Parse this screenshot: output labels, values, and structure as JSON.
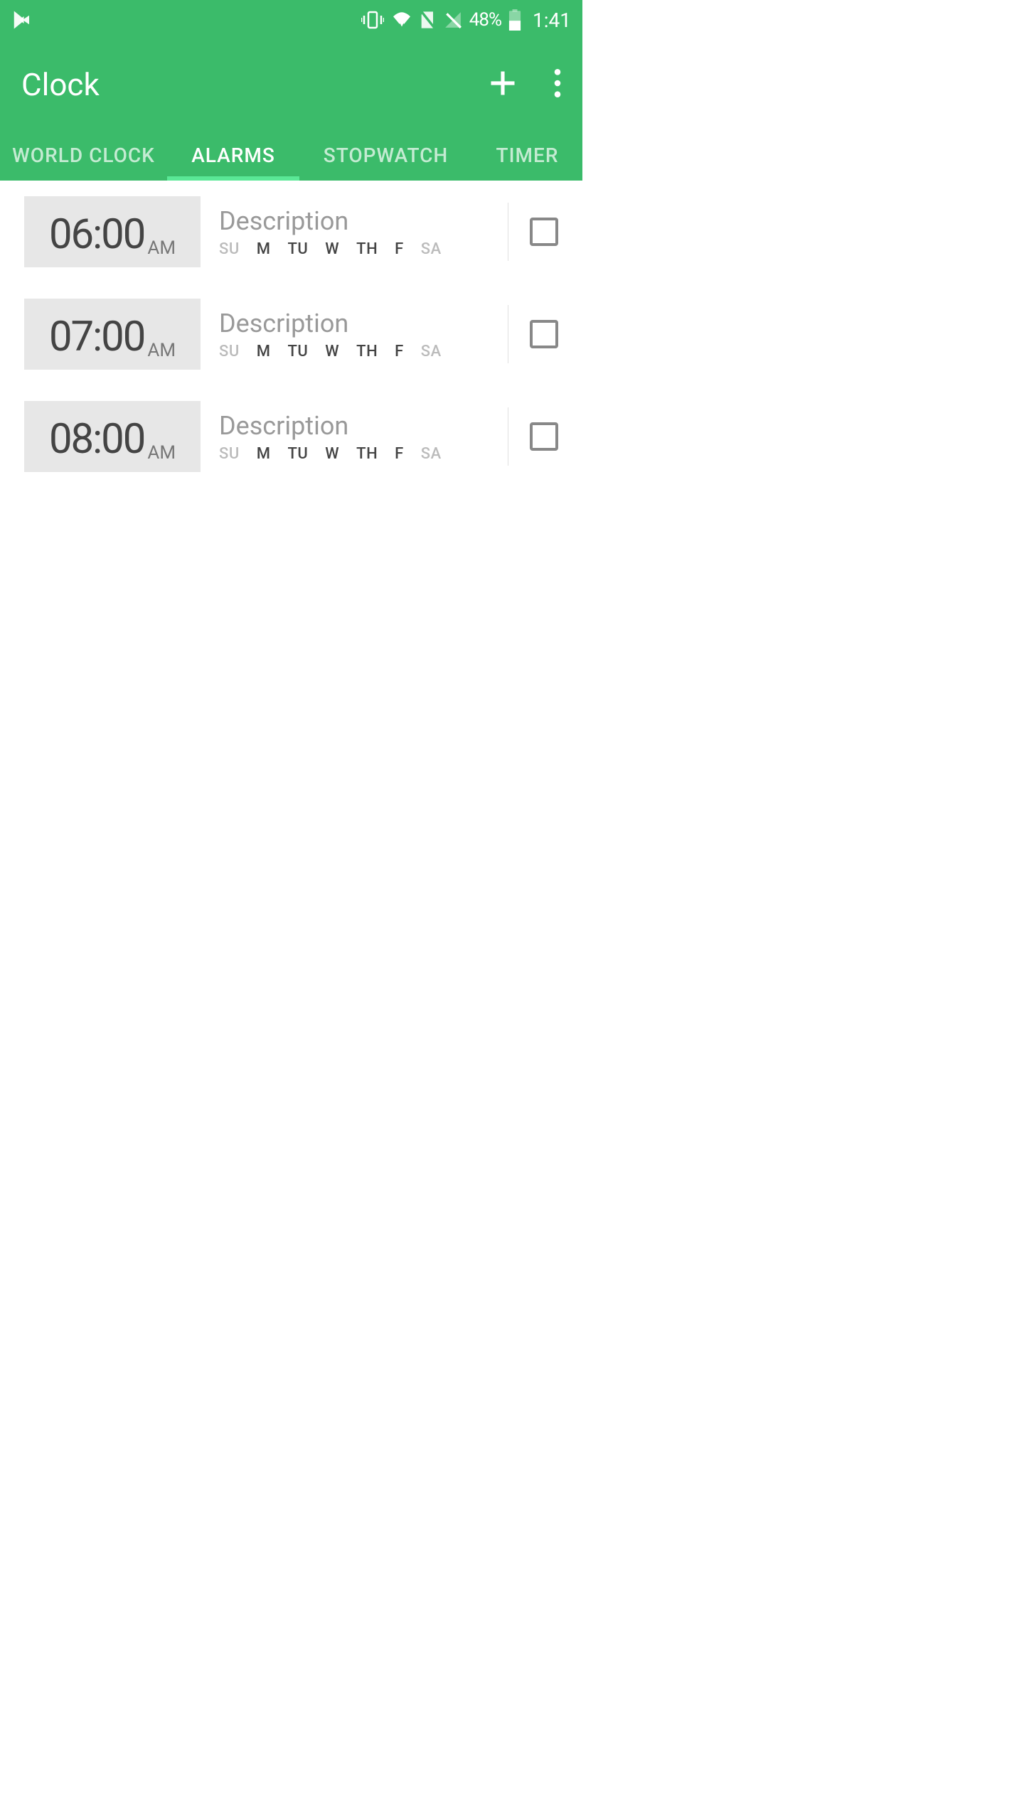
{
  "status_bar": {
    "battery_percent": "48%",
    "time": "1:41"
  },
  "header": {
    "title": "Clock"
  },
  "tabs": {
    "items": [
      "WORLD CLOCK",
      "ALARMS",
      "STOPWATCH",
      "TIMER"
    ],
    "active_index": 1
  },
  "alarms": [
    {
      "time": "06:00",
      "ampm": "AM",
      "description": "Description",
      "days": [
        {
          "label": "SU",
          "active": false
        },
        {
          "label": "M",
          "active": true
        },
        {
          "label": "TU",
          "active": true
        },
        {
          "label": "W",
          "active": true
        },
        {
          "label": "TH",
          "active": true
        },
        {
          "label": "F",
          "active": true
        },
        {
          "label": "SA",
          "active": false
        }
      ],
      "enabled": false
    },
    {
      "time": "07:00",
      "ampm": "AM",
      "description": "Description",
      "days": [
        {
          "label": "SU",
          "active": false
        },
        {
          "label": "M",
          "active": true
        },
        {
          "label": "TU",
          "active": true
        },
        {
          "label": "W",
          "active": true
        },
        {
          "label": "TH",
          "active": true
        },
        {
          "label": "F",
          "active": true
        },
        {
          "label": "SA",
          "active": false
        }
      ],
      "enabled": false
    },
    {
      "time": "08:00",
      "ampm": "AM",
      "description": "Description",
      "days": [
        {
          "label": "SU",
          "active": false
        },
        {
          "label": "M",
          "active": true
        },
        {
          "label": "TU",
          "active": true
        },
        {
          "label": "W",
          "active": true
        },
        {
          "label": "TH",
          "active": true
        },
        {
          "label": "F",
          "active": true
        },
        {
          "label": "SA",
          "active": false
        }
      ],
      "enabled": false
    }
  ]
}
